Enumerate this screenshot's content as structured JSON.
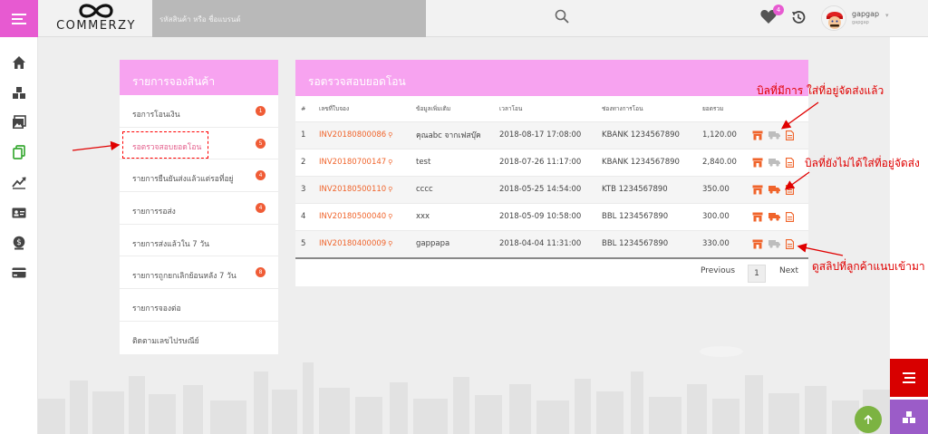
{
  "app": {
    "logo_text": "COMMERZY",
    "search_placeholder": "รหัสสินค้า หรือ ชื่อแบรนด์",
    "favorites_count": "4",
    "user_name": "gapgap",
    "user_sub": "gapgap"
  },
  "sidebar": {
    "title": "รายการจองสินค้า",
    "items": [
      {
        "label": "รอการโอนเงิน",
        "badge": "1"
      },
      {
        "label": "รอตรวจสอบยอดโอน",
        "badge": "5"
      },
      {
        "label": "รายการยืนยันส่งแล้วแต่รอที่อยู่",
        "badge": "4"
      },
      {
        "label": "รายการรอส่ง",
        "badge": "4"
      },
      {
        "label": "รายการส่งแล้วใน 7 วัน",
        "badge": ""
      },
      {
        "label": "รายการถูกยกเลิกย้อนหลัง 7 วัน",
        "badge": "8"
      },
      {
        "label": "รายการจองต่อ",
        "badge": ""
      },
      {
        "label": "ติดตามเลขไปรษณีย์",
        "badge": ""
      }
    ]
  },
  "main": {
    "title": "รอตรวจสอบยอดโอน",
    "columns": [
      "#",
      "เลขที่ใบจอง",
      "ข้อมูลเพิ่มเติม",
      "เวลาโอน",
      "ช่องทางการโอน",
      "ยอดรวม"
    ],
    "rows": [
      {
        "no": "1",
        "invoice": "INV20180800086",
        "info": "คุณabc จากเฟสบุ๊ค",
        "time": "2018-08-17 17:08:00",
        "channel": "KBANK 1234567890",
        "total": "1,120.00",
        "truck_active": false
      },
      {
        "no": "2",
        "invoice": "INV20180700147",
        "info": "test",
        "time": "2018-07-26 11:17:00",
        "channel": "KBANK 1234567890",
        "total": "2,840.00",
        "truck_active": false
      },
      {
        "no": "3",
        "invoice": "INV20180500110",
        "info": "cccc",
        "time": "2018-05-25 14:54:00",
        "channel": "KTB 1234567890",
        "total": "350.00",
        "truck_active": true
      },
      {
        "no": "4",
        "invoice": "INV20180500040",
        "info": "xxx",
        "time": "2018-05-09 10:58:00",
        "channel": "BBL 1234567890",
        "total": "300.00",
        "truck_active": true
      },
      {
        "no": "5",
        "invoice": "INV20180400009",
        "info": "gappapa",
        "time": "2018-04-04 11:31:00",
        "channel": "BBL 1234567890",
        "total": "330.00",
        "truck_active": false
      }
    ],
    "pager": {
      "previous": "Previous",
      "page": "1",
      "next": "Next"
    }
  },
  "annotations": {
    "has_address": "บิลที่มีการ ใส่ที่อยู่จัดส่งแล้ว",
    "no_address": "บิลที่ยังไม่ได้ใส่ที่อยู่จัดส่ง",
    "view_slip": "ดูสลิปที่ลูกค้าแนบเข้ามา"
  },
  "colors": {
    "accent_pink": "#f7a3f0",
    "menu_magenta": "#e75ad1",
    "invoice_orange": "#f0642b",
    "annotation_red": "#e00000"
  }
}
